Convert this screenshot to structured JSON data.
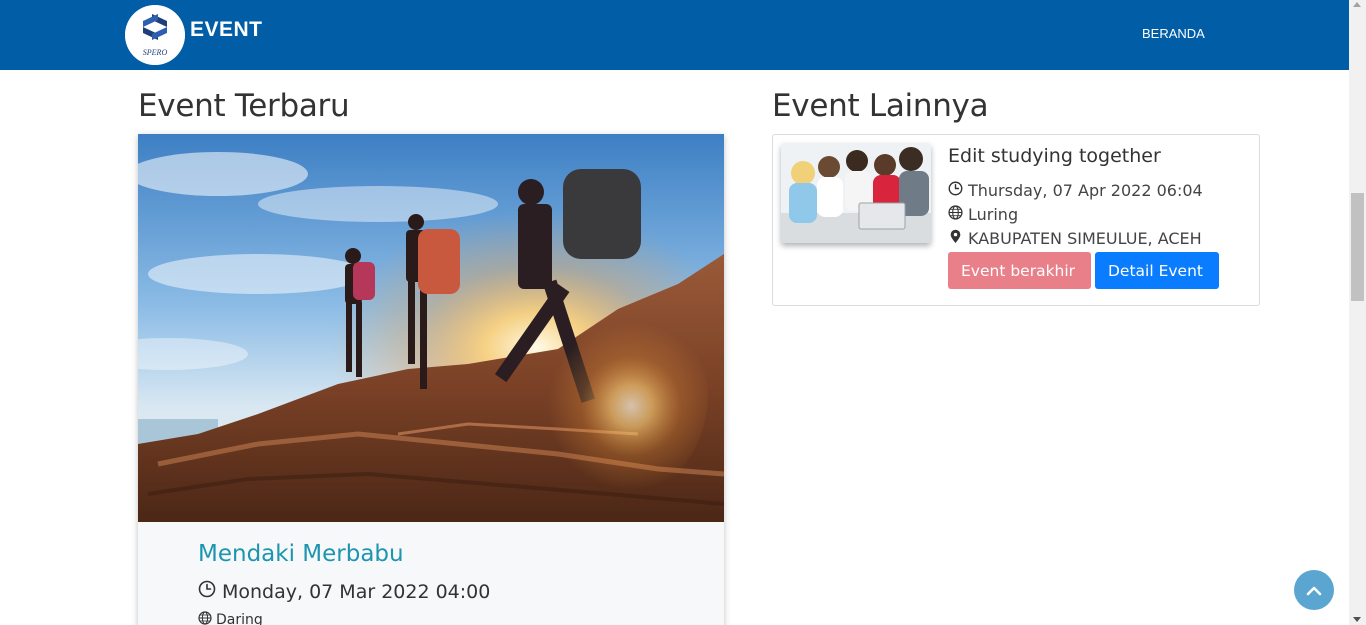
{
  "navbar": {
    "brand": "EVENT",
    "logo_icon": "spero-logo-icon",
    "links": [
      {
        "label": "BERANDA"
      }
    ]
  },
  "latest": {
    "heading": "Event Terbaru",
    "event": {
      "title": "Mendaki Merbabu",
      "datetime": "Monday, 07 Mar 2022 04:00",
      "mode": "Daring",
      "image_icon": "hiking-photo"
    }
  },
  "others": {
    "heading": "Event Lainnya",
    "events": [
      {
        "title": "Edit studying together",
        "datetime": "Thursday, 07 Apr 2022 06:04",
        "mode": "Luring",
        "location": "KABUPATEN SIMEULUE, ACEH",
        "status_label": "Event berakhir",
        "detail_label": "Detail Event",
        "image_icon": "students-photo"
      }
    ]
  },
  "colors": {
    "navbar": "#005da6",
    "title_link": "#1d95b1",
    "ended_button": "#e87f89",
    "detail_button": "#0a7cff",
    "back_to_top": "#5ba5d1"
  },
  "icons": [
    "clock-icon",
    "globe-icon",
    "map-pin-icon",
    "chevron-up-icon"
  ]
}
